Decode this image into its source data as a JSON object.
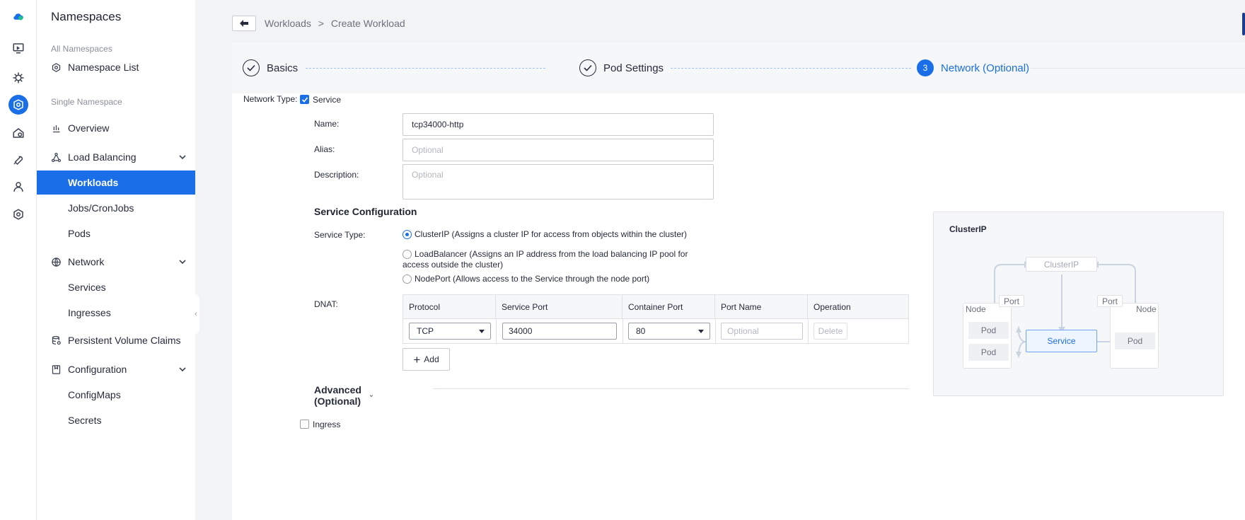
{
  "rail": {
    "icons": [
      "cloud-logo-icon",
      "monitor-icon",
      "helm-icon",
      "kubernetes-icon",
      "gear-home-icon",
      "wrench-icon",
      "user-icon",
      "hexagon-icon"
    ]
  },
  "sidebar": {
    "title": "Namespaces",
    "section_all": "All Namespaces",
    "namespace_list": "Namespace List",
    "section_single": "Single Namespace",
    "overview": "Overview",
    "load_balancing": "Load Balancing",
    "workloads": "Workloads",
    "jobs": "Jobs/CronJobs",
    "pods": "Pods",
    "network": "Network",
    "services": "Services",
    "ingresses": "Ingresses",
    "pvc": "Persistent Volume Claims",
    "configuration": "Configuration",
    "configmaps": "ConfigMaps",
    "secrets": "Secrets",
    "collapse_glyph": "‹"
  },
  "breadcrumb": {
    "parent": "Workloads",
    "separator": ">",
    "current": "Create Workload"
  },
  "steps": {
    "basics": "Basics",
    "pod_settings": "Pod Settings",
    "network_number": "3",
    "network": "Network (Optional)"
  },
  "form": {
    "network_type_label": "Network Type:",
    "service_checkbox_label": "Service",
    "service_checked": true,
    "name_label": "Name:",
    "name_value": "tcp34000-http",
    "alias_label": "Alias:",
    "alias_placeholder": "Optional",
    "description_label": "Description:",
    "description_placeholder": "Optional",
    "service_config_title": "Service Configuration",
    "service_type_label": "Service Type:",
    "service_type_options": [
      "ClusterIP (Assigns a cluster IP for access from objects within the cluster)",
      "LoadBalancer (Assigns an IP address from the load balancing IP pool for access outside the cluster)",
      "NodePort (Allows access to the Service through the node port)"
    ],
    "service_type_selected": "ClusterIP",
    "dnat_label": "DNAT:",
    "dnat_headers": [
      "Protocol",
      "Service Port",
      "Container Port",
      "Port Name",
      "Operation"
    ],
    "dnat_row": {
      "protocol": "TCP",
      "service_port": "34000",
      "container_port": "80",
      "port_name_placeholder": "Optional",
      "delete": "Delete"
    },
    "add_label": "Add",
    "advanced_label": "Advanced (Optional)",
    "ingress_label": "Ingress",
    "ingress_checked": false
  },
  "diagram": {
    "title": "ClusterIP",
    "clusterip": "ClusterIP",
    "node": "Node",
    "port": "Port",
    "pod": "Pod",
    "service": "Service"
  },
  "colors": {
    "accent": "#1a6ee8",
    "sidebar_active_bg": "#1a6ee8",
    "page_bg": "#f2f3f5"
  }
}
